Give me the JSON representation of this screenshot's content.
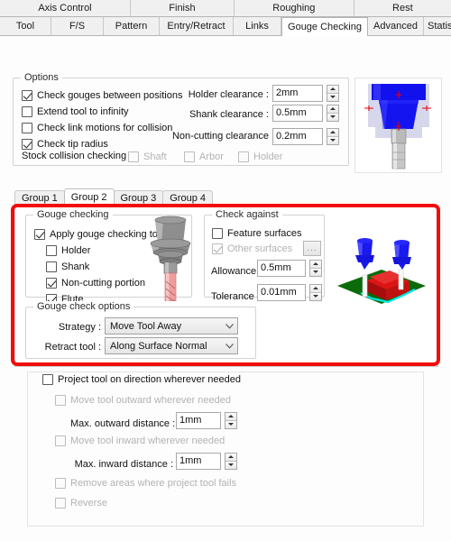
{
  "tabs_row1": [
    {
      "label": "Axis Control",
      "active": false
    },
    {
      "label": "Finish",
      "active": false
    },
    {
      "label": "Roughing",
      "active": false
    },
    {
      "label": "Rest",
      "active": false
    }
  ],
  "tabs_row2": [
    {
      "label": "Tool",
      "active": false
    },
    {
      "label": "F/S",
      "active": false
    },
    {
      "label": "Pattern",
      "active": false
    },
    {
      "label": "Entry/Retract",
      "active": false
    },
    {
      "label": "Links",
      "active": false
    },
    {
      "label": "Gouge Checking",
      "active": true
    },
    {
      "label": "Advanced",
      "active": false
    },
    {
      "label": "Statistics",
      "active": false
    }
  ],
  "options": {
    "title": "Options",
    "checks": [
      {
        "label": "Check gouges between positions",
        "checked": true,
        "disabled": false
      },
      {
        "label": "Extend tool to infinity",
        "checked": false,
        "disabled": false
      },
      {
        "label": "Check link motions for collision",
        "checked": false,
        "disabled": false
      },
      {
        "label": "Check tip radius",
        "checked": true,
        "disabled": false
      }
    ],
    "stock_label": "Stock collision checking",
    "stock_checks": [
      {
        "label": "Shaft",
        "checked": false,
        "disabled": true
      },
      {
        "label": "Arbor",
        "checked": false,
        "disabled": true
      },
      {
        "label": "Holder",
        "checked": false,
        "disabled": true
      }
    ],
    "fields": [
      {
        "label": "Holder clearance :",
        "value": "2mm"
      },
      {
        "label": "Shank clearance :",
        "value": "0.5mm"
      },
      {
        "label": "Non-cutting clearance",
        "value": "0.2mm"
      }
    ]
  },
  "group_tabs": [
    {
      "label": "Group 1",
      "active": false
    },
    {
      "label": "Group 2",
      "active": true
    },
    {
      "label": "Group 3",
      "active": false
    },
    {
      "label": "Group 4",
      "active": false
    }
  ],
  "gouge_checking": {
    "title": "Gouge checking",
    "apply_label": "Apply gouge checking to",
    "apply_checked": true,
    "items": [
      {
        "label": "Holder",
        "checked": false
      },
      {
        "label": "Shank",
        "checked": false
      },
      {
        "label": "Non-cutting portion",
        "checked": true
      },
      {
        "label": "Flute",
        "checked": true
      }
    ]
  },
  "check_against": {
    "title": "Check against",
    "feature_surfaces": {
      "label": "Feature surfaces",
      "checked": false,
      "disabled": false
    },
    "other_surfaces": {
      "label": "Other surfaces",
      "checked": true,
      "disabled": true
    },
    "dots_button": "...",
    "allowance": {
      "label": "Allowance :",
      "value": "0.5mm"
    },
    "tolerance": {
      "label": "Tolerance :",
      "value": "0.01mm"
    }
  },
  "gouge_check_options": {
    "title": "Gouge check options",
    "strategy": {
      "label": "Strategy :",
      "value": "Move Tool Away"
    },
    "retract_tool": {
      "label": "Retract tool :",
      "value": "Along Surface Normal"
    }
  },
  "project": {
    "main": {
      "label": "Project tool on direction wherever needed",
      "checked": false,
      "disabled": false
    },
    "outward_check": {
      "label": "Move tool outward wherever needed",
      "checked": false,
      "disabled": true
    },
    "outward_field": {
      "label": "Max. outward distance :",
      "value": "1mm"
    },
    "inward_check": {
      "label": "Move tool inward wherever needed",
      "checked": false,
      "disabled": true
    },
    "inward_field": {
      "label": "Max. inward distance :",
      "value": "1mm"
    },
    "remove_areas": {
      "label": "Remove areas where project tool fails",
      "checked": false,
      "disabled": true
    },
    "reverse": {
      "label": "Reverse",
      "checked": false,
      "disabled": true
    }
  },
  "colors": {
    "highlight": "#f20d0d",
    "holder_blue": "#1111ee",
    "stock_gray": "#b8b8c8",
    "shank_gray": "#c3c3c3",
    "flute_pink": "#ee9c9c",
    "part_red": "#cc1111",
    "ground_green": "#0a6b0a",
    "toolpath_cyan": "#00e5e5"
  },
  "previews": {
    "top_right": "holder-clearance-3d-preview",
    "gouge_tool": "tool-assembly-3d-preview",
    "gouge_scene": "gouge-check-scene-3d-preview"
  }
}
